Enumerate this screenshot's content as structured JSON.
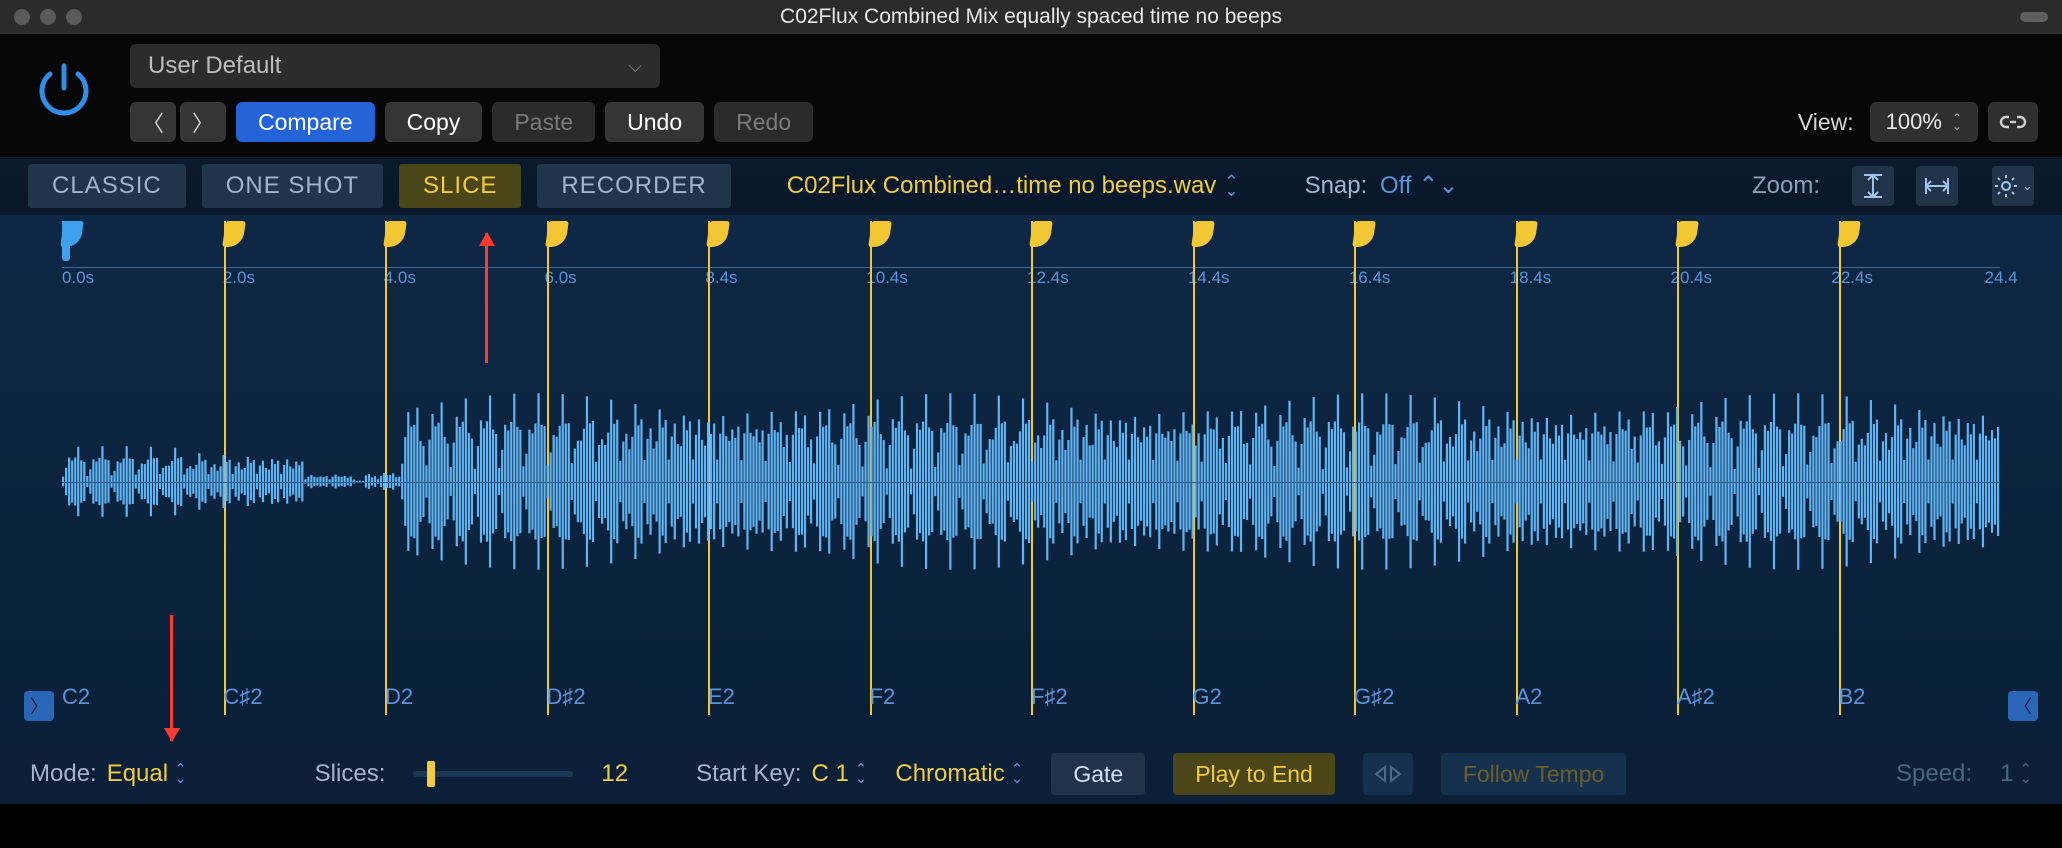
{
  "window": {
    "title": "C02Flux Combined Mix equally spaced time no beeps"
  },
  "toolbar": {
    "preset": "User Default",
    "compare": "Compare",
    "copy": "Copy",
    "paste": "Paste",
    "undo": "Undo",
    "redo": "Redo",
    "view_label": "View:",
    "view_value": "100%"
  },
  "tabs": {
    "classic": "CLASSIC",
    "oneshot": "ONE SHOT",
    "slice": "SLICE",
    "recorder": "RECORDER"
  },
  "file": {
    "name": "C02Flux Combined…time no beeps.wav"
  },
  "snap": {
    "label": "Snap:",
    "value": "Off"
  },
  "zoom": {
    "label": "Zoom:"
  },
  "timeline": {
    "ticks": [
      "0.0s",
      "2.0s",
      "4.0s",
      "6.0s",
      "8.4s",
      "10.4s",
      "12.4s",
      "14.4s",
      "16.4s",
      "18.4s",
      "20.4s",
      "22.4s",
      "24.4"
    ],
    "notes": [
      "C2",
      "C♯2",
      "D2",
      "D♯2",
      "E2",
      "F2",
      "F♯2",
      "G2",
      "G♯2",
      "A2",
      "A♯2",
      "B2"
    ],
    "slice_count": 12
  },
  "footer": {
    "mode_label": "Mode:",
    "mode_value": "Equal",
    "slices_label": "Slices:",
    "slices_value": "12",
    "startkey_label": "Start Key:",
    "startkey_value": "C 1",
    "scale": "Chromatic",
    "gate": "Gate",
    "play_to_end": "Play to End",
    "follow_tempo": "Follow Tempo",
    "speed_label": "Speed:",
    "speed_value": "1"
  }
}
